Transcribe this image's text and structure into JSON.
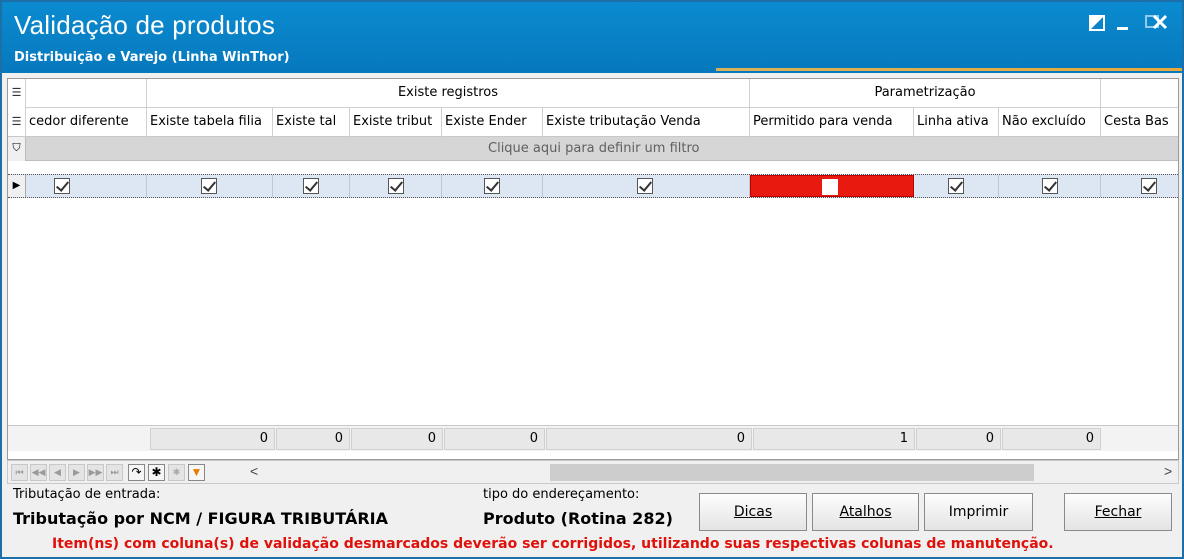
{
  "window": {
    "title": "Validação de produtos",
    "subtitle": "Distribuição e Varejo (Linha WinThor)"
  },
  "grid": {
    "bands": [
      {
        "label": ""
      },
      {
        "label": "Existe registros"
      },
      {
        "label": "Parametrização"
      },
      {
        "label": ""
      }
    ],
    "columns": [
      "cedor diferente",
      "Existe tabela filia",
      "Existe tal",
      "Existe tribut",
      "Existe Ender",
      "Existe tributação Venda",
      "Permitido para venda",
      "Linha ativa",
      "Não excluído",
      "Cesta Bas"
    ],
    "filter_text": "Clique aqui para definir um filtro",
    "row": [
      true,
      true,
      true,
      true,
      true,
      true,
      false,
      true,
      true,
      true
    ],
    "totals": [
      "0",
      "0",
      "0",
      "0",
      "0",
      "1",
      "0",
      "0"
    ]
  },
  "navigator": {
    "icons": [
      "first-icon",
      "prev-page-icon",
      "prev-icon",
      "next-icon",
      "next-page-icon",
      "last-icon",
      "refresh-icon",
      "insert-icon",
      "delete-icon",
      "filter-icon"
    ],
    "scroll_left": "<",
    "scroll_right": ">"
  },
  "bottom": {
    "entrada_label": "Tributação de entrada:",
    "entrada_value": "Tributação por NCM / FIGURA TRIBUTÁRIA",
    "endereco_label": "tipo do endereçamento:",
    "endereco_value": "Produto (Rotina 282)",
    "buttons": {
      "dicas": "Dicas",
      "atalhos": "Atalhos",
      "imprimir": "Imprimir",
      "fechar": "Fechar"
    },
    "warning": "Item(ns) com coluna(s) de validação desmarcados deverão ser corrigidos, utilizando suas respectivas colunas de manutenção."
  }
}
